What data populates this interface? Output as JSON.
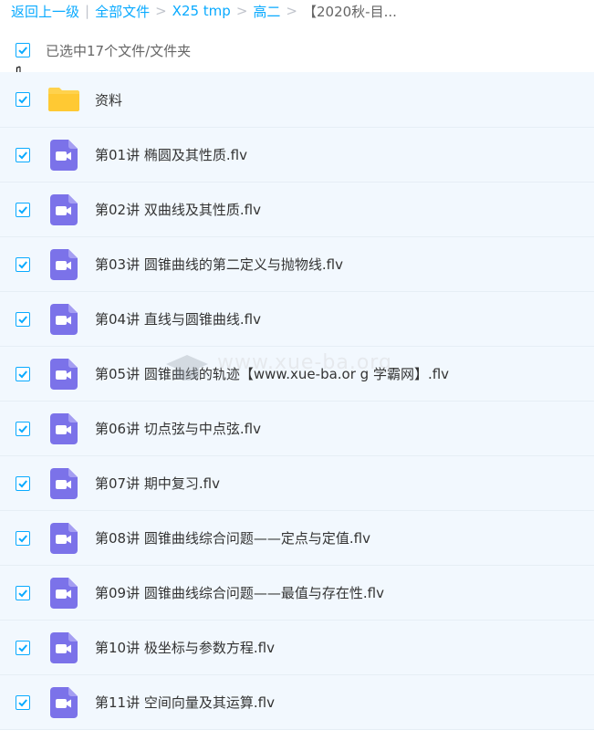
{
  "breadcrumb": {
    "back": "返回上一级",
    "all_files": "全部文件",
    "folder1": "X25 tmp",
    "folder2": "高二",
    "current": "【2020秋-目..."
  },
  "selection": {
    "text": "已选中17个文件/文件夹"
  },
  "watermark": {
    "text": "www.xue-ba.org"
  },
  "colors": {
    "accent": "#09aaff",
    "video_icon": "#7b72e9",
    "folder": "#ffd24d",
    "row_bg": "#f2f8fe"
  },
  "items": [
    {
      "name": "资料",
      "type": "folder",
      "checked": true
    },
    {
      "name": "第01讲 椭圆及其性质.flv",
      "type": "video",
      "checked": true
    },
    {
      "name": "第02讲 双曲线及其性质.flv",
      "type": "video",
      "checked": true
    },
    {
      "name": "第03讲 圆锥曲线的第二定义与抛物线.flv",
      "type": "video",
      "checked": true
    },
    {
      "name": "第04讲 直线与圆锥曲线.flv",
      "type": "video",
      "checked": true
    },
    {
      "name": "第05讲 圆锥曲线的轨迹【www.xue-ba.or g 学霸网】.flv",
      "type": "video",
      "checked": true
    },
    {
      "name": "第06讲 切点弦与中点弦.flv",
      "type": "video",
      "checked": true
    },
    {
      "name": "第07讲 期中复习.flv",
      "type": "video",
      "checked": true
    },
    {
      "name": "第08讲 圆锥曲线综合问题——定点与定值.flv",
      "type": "video",
      "checked": true
    },
    {
      "name": "第09讲 圆锥曲线综合问题——最值与存在性.flv",
      "type": "video",
      "checked": true
    },
    {
      "name": "第10讲 极坐标与参数方程.flv",
      "type": "video",
      "checked": true
    },
    {
      "name": "第11讲 空间向量及其运算.flv",
      "type": "video",
      "checked": true
    }
  ]
}
